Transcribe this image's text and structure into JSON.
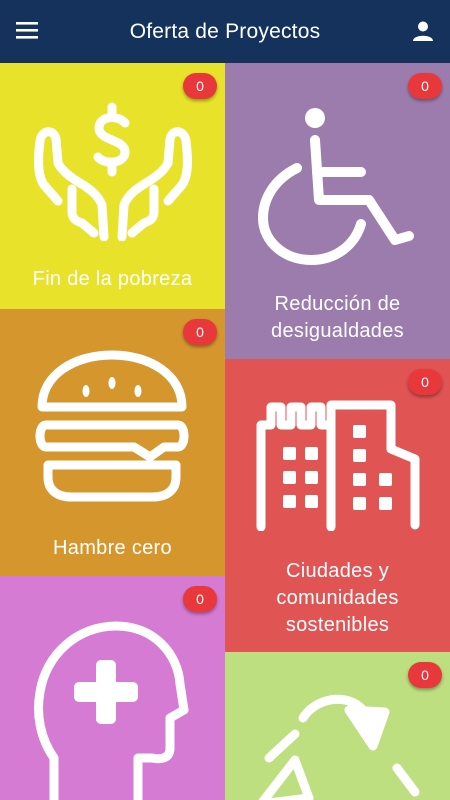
{
  "appbar": {
    "title": "Oferta de Proyectos",
    "menu_icon": "hamburger-menu-icon",
    "user_icon": "account-icon",
    "color": "#14325c"
  },
  "tiles": [
    {
      "label": "Fin de la pobreza",
      "badge": "0",
      "color": "#e9e22b",
      "icon": "hands-dollar-icon"
    },
    {
      "label": "Reducción de desigualdades",
      "badge": "0",
      "color": "#9c7cac",
      "icon": "wheelchair-icon"
    },
    {
      "label": "Hambre cero",
      "badge": "0",
      "color": "#d5962e",
      "icon": "burger-icon"
    },
    {
      "label": "Ciudades y comunidades sostenibles",
      "badge": "0",
      "color": "#e05454",
      "icon": "city-icon"
    },
    {
      "label": "",
      "badge": "0",
      "color": "#d67bd3",
      "icon": "head-health-icon"
    },
    {
      "label": "",
      "badge": "0",
      "color": "#bddf7f",
      "icon": "recycle-icon"
    }
  ]
}
